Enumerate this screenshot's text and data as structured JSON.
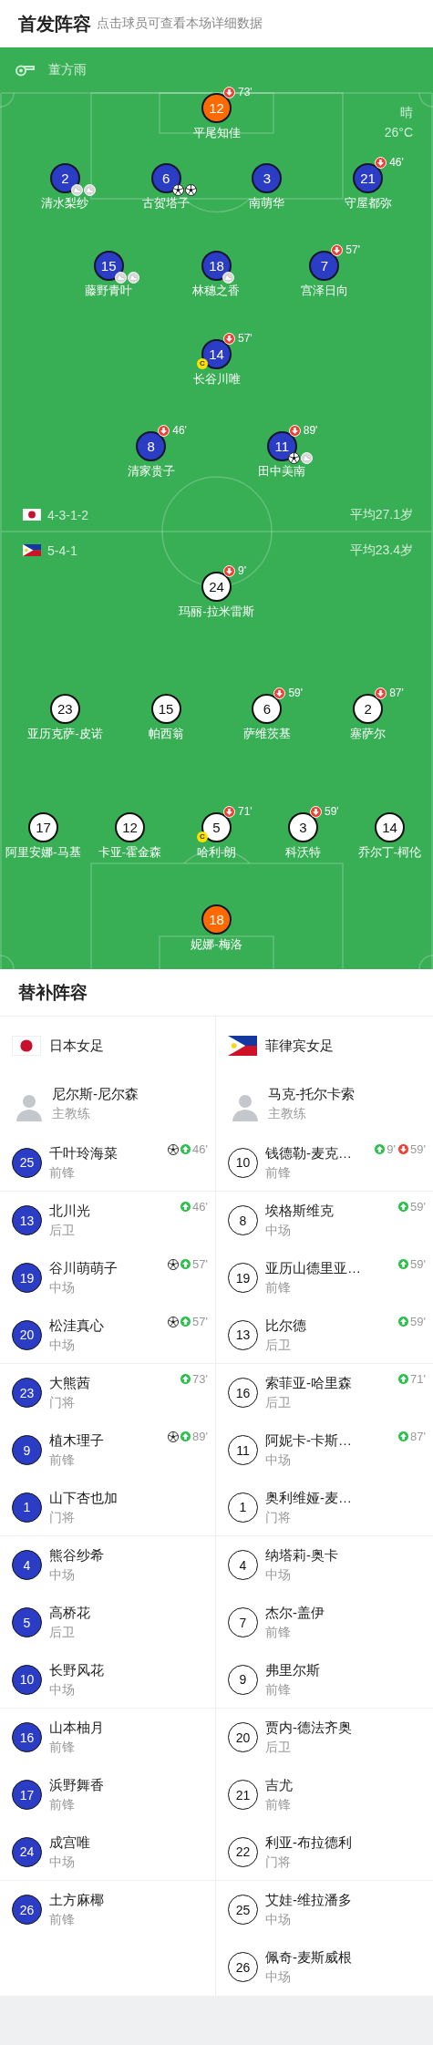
{
  "header": {
    "title": "首发阵容",
    "subtitle": "点击球员可查看本场详细数据"
  },
  "match": {
    "referee": "董方雨",
    "weather": "晴",
    "temperature": "26°C"
  },
  "bench_title": "替补阵容",
  "teams": [
    {
      "kind": "home",
      "name": "日本女足",
      "formation": "4-3-1-2",
      "average_age": "平均27.1岁",
      "coach": {
        "name": "尼尔斯-尼尔森",
        "role": "主教练"
      },
      "lines": [
        [
          {
            "number": "12",
            "name": "平尾知佳",
            "kind": "goalkeeper",
            "events": [
              {
                "kind": "sub_off",
                "minute": "73'"
              }
            ]
          }
        ],
        [
          {
            "number": "2",
            "name": "清水梨纱",
            "kind": "outfield",
            "events": [
              {
                "kind": "assist"
              },
              {
                "kind": "assist"
              }
            ]
          },
          {
            "number": "6",
            "name": "古贺塔子",
            "kind": "outfield",
            "events": [
              {
                "kind": "goal"
              },
              {
                "kind": "goal"
              }
            ]
          },
          {
            "number": "3",
            "name": "南萌华",
            "kind": "outfield"
          },
          {
            "number": "21",
            "name": "守屋都弥",
            "kind": "outfield",
            "events": [
              {
                "kind": "sub_off",
                "minute": "46'"
              }
            ]
          }
        ],
        [
          {
            "number": "15",
            "name": "藤野青叶",
            "kind": "outfield",
            "events": [
              {
                "kind": "assist"
              },
              {
                "kind": "assist"
              }
            ]
          },
          {
            "number": "18",
            "name": "林穗之香",
            "kind": "outfield",
            "events": [
              {
                "kind": "assist"
              }
            ]
          },
          {
            "number": "7",
            "name": "宫泽日向",
            "kind": "outfield",
            "events": [
              {
                "kind": "sub_off",
                "minute": "57'"
              }
            ]
          }
        ],
        [
          {
            "number": "14",
            "name": "长谷川唯",
            "kind": "outfield",
            "captain_badge": "C",
            "events": [
              {
                "kind": "sub_off",
                "minute": "57'"
              }
            ]
          }
        ],
        [
          {
            "number": "8",
            "name": "清家贵子",
            "kind": "outfield",
            "events": [
              {
                "kind": "sub_off",
                "minute": "46'"
              }
            ]
          },
          {
            "number": "11",
            "name": "田中美南",
            "kind": "outfield",
            "events": [
              {
                "kind": "sub_off",
                "minute": "89'"
              },
              {
                "kind": "goal"
              },
              {
                "kind": "assist"
              }
            ]
          }
        ]
      ],
      "substitutes": [
        {
          "number": "25",
          "name": "千叶玲海菜",
          "position": "前锋",
          "events": [
            {
              "kind": "goal"
            },
            {
              "kind": "sub_in",
              "minute": "46'"
            }
          ]
        },
        {
          "number": "13",
          "name": "北川光",
          "position": "后卫",
          "events": [
            {
              "kind": "sub_in",
              "minute": "46'"
            }
          ]
        },
        {
          "number": "19",
          "name": "谷川萌萌子",
          "position": "中场",
          "events": [
            {
              "kind": "goal"
            },
            {
              "kind": "sub_in",
              "minute": "57'"
            }
          ]
        },
        {
          "number": "20",
          "name": "松洼真心",
          "position": "中场",
          "events": [
            {
              "kind": "goal"
            },
            {
              "kind": "sub_in",
              "minute": "57'"
            }
          ]
        },
        {
          "number": "23",
          "name": "大熊茜",
          "position": "门将",
          "events": [
            {
              "kind": "sub_in",
              "minute": "73'"
            }
          ]
        },
        {
          "number": "9",
          "name": "植木理子",
          "position": "前锋",
          "events": [
            {
              "kind": "goal"
            },
            {
              "kind": "sub_in",
              "minute": "89'"
            }
          ]
        },
        {
          "number": "1",
          "name": "山下杏也加",
          "position": "门将"
        },
        {
          "number": "4",
          "name": "熊谷纱希",
          "position": "中场"
        },
        {
          "number": "5",
          "name": "高桥花",
          "position": "后卫"
        },
        {
          "number": "10",
          "name": "长野风花",
          "position": "中场"
        },
        {
          "number": "16",
          "name": "山本柚月",
          "position": "前锋"
        },
        {
          "number": "17",
          "name": "浜野舞香",
          "position": "前锋"
        },
        {
          "number": "24",
          "name": "成宫唯",
          "position": "中场"
        },
        {
          "number": "26",
          "name": "土方麻椰",
          "position": "前锋"
        }
      ]
    },
    {
      "kind": "away",
      "name": "菲律宾女足",
      "formation": "5-4-1",
      "average_age": "平均23.4岁",
      "coach": {
        "name": "马克-托尔卡索",
        "role": "主教练"
      },
      "lines": [
        [
          {
            "number": "24",
            "name": "玛丽-拉米雷斯",
            "kind": "outfield",
            "events": [
              {
                "kind": "sub_off",
                "minute": "9'"
              }
            ]
          }
        ],
        [
          {
            "number": "23",
            "name": "亚历克萨-皮诺",
            "kind": "outfield"
          },
          {
            "number": "15",
            "name": "帕西翁",
            "kind": "outfield"
          },
          {
            "number": "6",
            "name": "萨维茨基",
            "kind": "outfield",
            "events": [
              {
                "kind": "sub_off",
                "minute": "59'"
              }
            ]
          },
          {
            "number": "2",
            "name": "塞萨尔",
            "kind": "outfield",
            "events": [
              {
                "kind": "sub_off",
                "minute": "87'"
              }
            ]
          }
        ],
        [
          {
            "number": "17",
            "name": "阿里安娜-马基",
            "kind": "outfield"
          },
          {
            "number": "12",
            "name": "卡亚-霍金森",
            "kind": "outfield"
          },
          {
            "number": "5",
            "name": "哈利-朗",
            "kind": "outfield",
            "captain_badge": "C",
            "events": [
              {
                "kind": "sub_off",
                "minute": "71'"
              }
            ]
          },
          {
            "number": "3",
            "name": "科沃特",
            "kind": "outfield",
            "events": [
              {
                "kind": "sub_off",
                "minute": "59'"
              }
            ]
          },
          {
            "number": "14",
            "name": "乔尔丁-柯伦",
            "kind": "outfield"
          }
        ],
        [
          {
            "number": "18",
            "name": "妮娜-梅洛",
            "kind": "goalkeeper"
          }
        ]
      ],
      "substitutes": [
        {
          "number": "10",
          "name": "钱德勒-麦克…",
          "position": "前锋",
          "events": [
            {
              "kind": "sub_in",
              "minute": "9'"
            },
            {
              "kind": "sub_off",
              "minute": "59'"
            }
          ]
        },
        {
          "number": "8",
          "name": "埃格斯维克",
          "position": "中场",
          "events": [
            {
              "kind": "sub_in",
              "minute": "59'"
            }
          ]
        },
        {
          "number": "19",
          "name": "亚历山德里亚…",
          "position": "前锋",
          "events": [
            {
              "kind": "sub_in",
              "minute": "59'"
            }
          ]
        },
        {
          "number": "13",
          "name": "比尔德",
          "position": "后卫",
          "events": [
            {
              "kind": "sub_in",
              "minute": "59'"
            }
          ]
        },
        {
          "number": "16",
          "name": "索菲亚-哈里森",
          "position": "后卫",
          "events": [
            {
              "kind": "sub_in",
              "minute": "71'"
            }
          ]
        },
        {
          "number": "11",
          "name": "阿妮卡-卡斯…",
          "position": "中场",
          "events": [
            {
              "kind": "sub_in",
              "minute": "87'"
            }
          ]
        },
        {
          "number": "1",
          "name": "奥利维娅-麦…",
          "position": "门将"
        },
        {
          "number": "4",
          "name": "纳塔莉-奥卡",
          "position": "中场"
        },
        {
          "number": "7",
          "name": "杰尔-盖伊",
          "position": "前锋"
        },
        {
          "number": "9",
          "name": "弗里尔斯",
          "position": "前锋"
        },
        {
          "number": "20",
          "name": "贾内-德法齐奥",
          "position": "后卫"
        },
        {
          "number": "21",
          "name": "吉尤",
          "position": "前锋"
        },
        {
          "number": "22",
          "name": "利亚-布拉德利",
          "position": "门将"
        },
        {
          "number": "25",
          "name": "艾娃-维拉潘多",
          "position": "中场"
        },
        {
          "number": "26",
          "name": "佩奇-麦斯威根",
          "position": "中场"
        }
      ]
    }
  ]
}
